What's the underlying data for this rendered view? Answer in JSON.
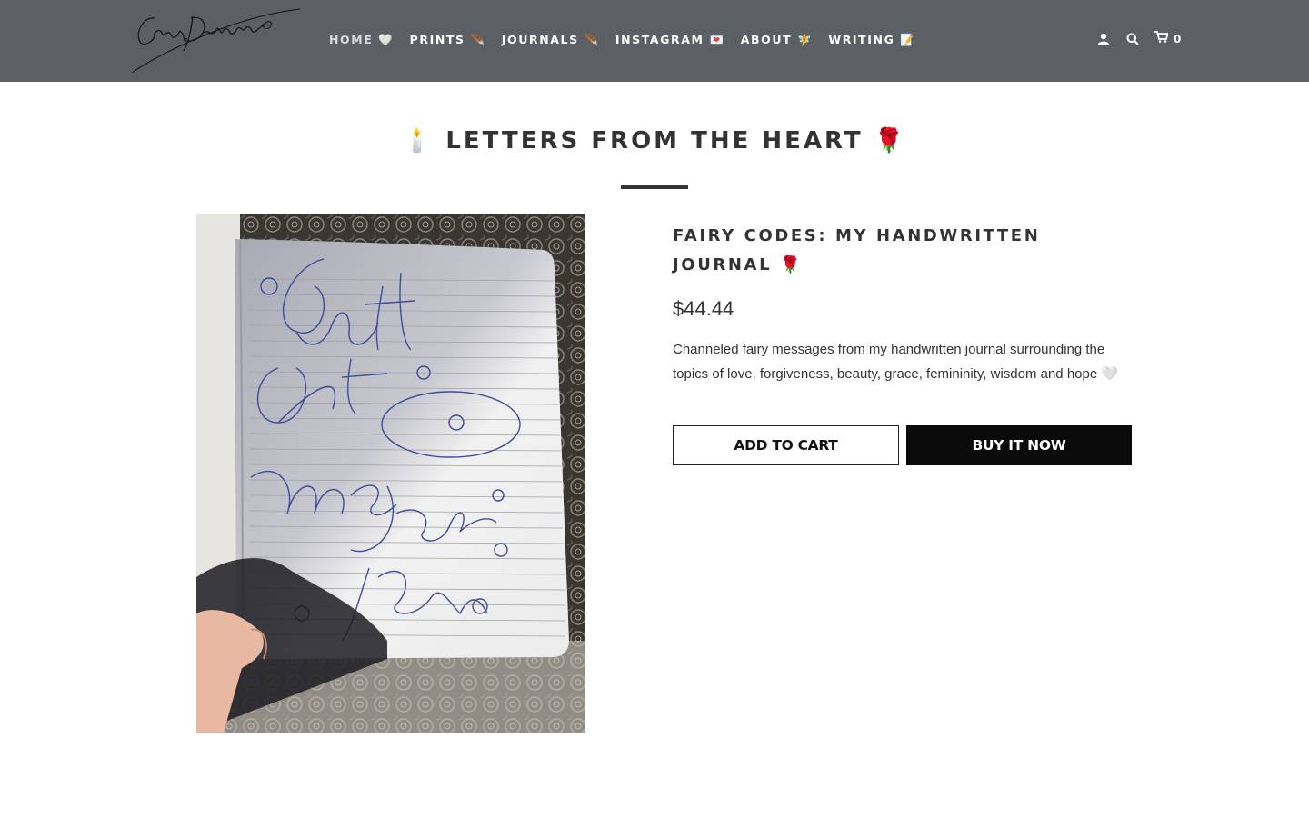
{
  "header": {
    "logo_text": "Sarah Dalessandro",
    "nav": [
      {
        "label": "HOME 🤍",
        "active": true
      },
      {
        "label": "PRINTS 🪶",
        "active": false
      },
      {
        "label": "JOURNALS 🪶",
        "active": false
      },
      {
        "label": "INSTAGRAM 💌",
        "active": false
      },
      {
        "label": "ABOUT 🧚",
        "active": false
      },
      {
        "label": "WRITING 📝",
        "active": false
      }
    ],
    "icons": [
      "account-icon",
      "search-icon",
      "cart-icon"
    ],
    "cart_count": "0",
    "background": "#5c5f63"
  },
  "page": {
    "title": "🕯️ LETTERS FROM THE HEART 🌹"
  },
  "product": {
    "image_alt": "Handwritten journal page reading Just Let Me Love You",
    "image_text": [
      "Just",
      "Let",
      "me Love",
      "You"
    ],
    "name": "FAIRY CODES: MY HANDWRITTEN JOURNAL 🌹",
    "price": "$44.44",
    "description": "Channeled fairy messages from my handwritten journal surrounding the topics of love, forgiveness, beauty, grace, femininity, wisdom and hope 🤍",
    "add_to_cart_label": "ADD TO CART",
    "buy_now_label": "BUY IT NOW",
    "buy_button_color": "#0a0a0a"
  }
}
